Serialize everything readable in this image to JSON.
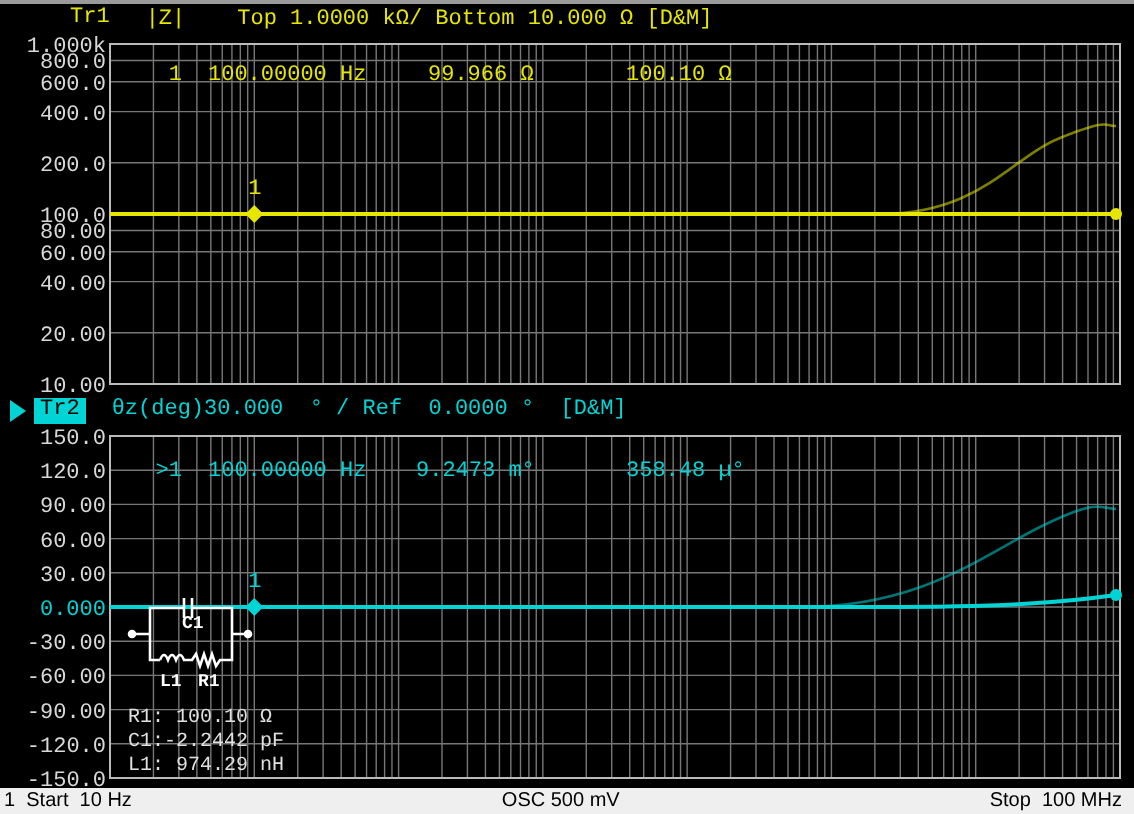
{
  "traces": [
    {
      "label": "Tr1",
      "selected": false,
      "kind": "magnitude",
      "color": "#e6e600",
      "parameter": "|Z|",
      "scale": "Top 1.0000 kΩ/ Bottom 10.000 Ω [D&M]",
      "y_labels": [
        {
          "text": "1.000k",
          "reference": false
        },
        {
          "text": "800.0",
          "reference": false
        },
        {
          "text": "600.0",
          "reference": false
        },
        {
          "text": "400.0",
          "reference": false
        },
        {
          "text": "200.0",
          "reference": false
        },
        {
          "text": "100.0",
          "reference": false
        },
        {
          "text": "80.00",
          "reference": false
        },
        {
          "text": "60.00",
          "reference": false
        },
        {
          "text": "40.00",
          "reference": false
        },
        {
          "text": "20.00",
          "reference": false
        },
        {
          "text": "10.00",
          "reference": false
        }
      ],
      "marker": {
        "label": "1",
        "readout": [
          "1",
          "100.00000 Hz",
          "99.966 Ω",
          "100.10 Ω"
        ]
      }
    },
    {
      "label": "Tr2",
      "selected": true,
      "kind": "phase",
      "color": "#00d4d4",
      "parameter": "θz(deg)",
      "scale": "30.000  ° / Ref  0.0000 °  [D&M]",
      "y_labels": [
        {
          "text": "150.0",
          "reference": false
        },
        {
          "text": "120.0",
          "reference": false
        },
        {
          "text": "90.00",
          "reference": false
        },
        {
          "text": "60.00",
          "reference": false
        },
        {
          "text": "30.00",
          "reference": false
        },
        {
          "text": "0.000",
          "reference": true
        },
        {
          "text": "-30.00",
          "reference": false
        },
        {
          "text": "-60.00",
          "reference": false
        },
        {
          "text": "-90.00",
          "reference": false
        },
        {
          "text": "-120.0",
          "reference": false
        },
        {
          "text": "-150.0",
          "reference": false
        }
      ],
      "marker": {
        "label": "1",
        "readout": [
          ">1",
          "100.00000 Hz",
          "9.2473 m°",
          "358.48 µ°"
        ]
      },
      "circuit": {
        "labels": [
          "C1",
          "L1",
          "R1"
        ],
        "values": [
          "R1: 100.10 Ω",
          "C1:-2.2442 pF",
          "L1: 974.29 nH"
        ]
      }
    }
  ],
  "status_bar": {
    "start": "1  Start  10 Hz",
    "osc": "OSC 500 mV",
    "stop": "Stop  100 MHz"
  }
}
